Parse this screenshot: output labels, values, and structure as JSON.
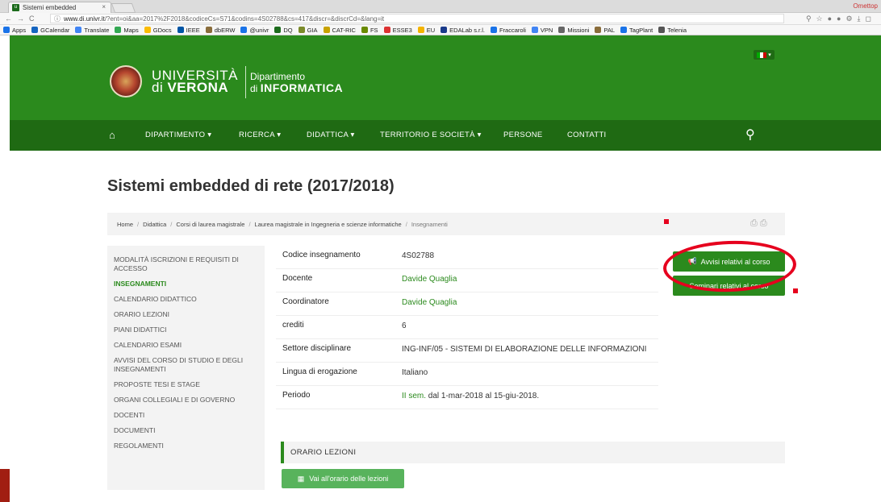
{
  "browser": {
    "tab_title": "Sistemi embedded",
    "tab_close": "×",
    "profile": "Omettop",
    "url_host": "www.di.univr.it",
    "url_rest": "/?ent=oi&aa=2017%2F2018&codiceCs=S71&codins=4S02788&cs=417&discr=&discrCd=&lang=it",
    "bookmarks": [
      "Apps",
      "GCalendar",
      "Translate",
      "Maps",
      "GDocs",
      "IEEE",
      "dbERW",
      "@univr",
      "DQ",
      "GIA",
      "CAT-RIC",
      "FS",
      "ESSE3",
      "EU",
      "EDALab s.r.l.",
      "Fraccaroli",
      "VPN",
      "Missioni",
      "PAL",
      "TagPlant",
      "Telenia"
    ]
  },
  "header": {
    "uni_line1": "UNIVERSITÀ",
    "uni_line2_prefix": "di ",
    "uni_line2": "VERONA",
    "dept_line1": "Dipartimento",
    "dept_line2_prefix": "di ",
    "dept_line2": "INFORMATICA"
  },
  "nav": {
    "items": [
      "DIPARTIMENTO ▾",
      "RICERCA ▾",
      "DIDATTICA ▾",
      "TERRITORIO E SOCIETÀ ▾",
      "PERSONE",
      "CONTATTI"
    ]
  },
  "page": {
    "title": "Sistemi embedded di rete (2017/2018)",
    "breadcrumbs": [
      "Home",
      "Didattica",
      "Corsi di laurea magistrale",
      "Laurea magistrale in Ingegneria e scienze informatiche",
      "Insegnamenti"
    ]
  },
  "sidebar": {
    "items": [
      "MODALITÀ ISCRIZIONI E REQUISITI DI ACCESSO",
      "INSEGNAMENTI",
      "CALENDARIO DIDATTICO",
      "ORARIO LEZIONI",
      "PIANI DIDATTICI",
      "CALENDARIO ESAMI",
      "AVVISI DEL CORSO DI STUDIO E DEGLI INSEGNAMENTI",
      "PROPOSTE TESI E STAGE",
      "ORGANI COLLEGIALI E DI GOVERNO",
      "DOCENTI",
      "DOCUMENTI",
      "REGOLAMENTI"
    ],
    "active_index": 1
  },
  "info": {
    "rows": [
      {
        "k": "Codice insegnamento",
        "v": "4S02788"
      },
      {
        "k": "Docente",
        "v": "Davide Quaglia"
      },
      {
        "k": "Coordinatore",
        "v": "Davide Quaglia"
      },
      {
        "k": "crediti",
        "v": "6"
      },
      {
        "k": "Settore disciplinare",
        "v": "ING-INF/05 - SISTEMI DI ELABORAZIONE DELLE INFORMAZIONI"
      },
      {
        "k": "Lingua di erogazione",
        "v": "Italiano"
      },
      {
        "k": "Periodo",
        "v_link": "II sem.",
        "v": "dal 1-mar-2018 al 15-giu-2018."
      }
    ]
  },
  "section": {
    "title": "ORARIO LEZIONI",
    "button": "Vai all'orario delle lezioni"
  },
  "buttons": {
    "avvisi": "Avvisi relativi al corso",
    "seminari": "Seminari relativi al corso"
  },
  "colors": {
    "brand_green": "#2b8a1d",
    "nav_green": "#1f6a13",
    "annotation_red": "#e6001e"
  }
}
